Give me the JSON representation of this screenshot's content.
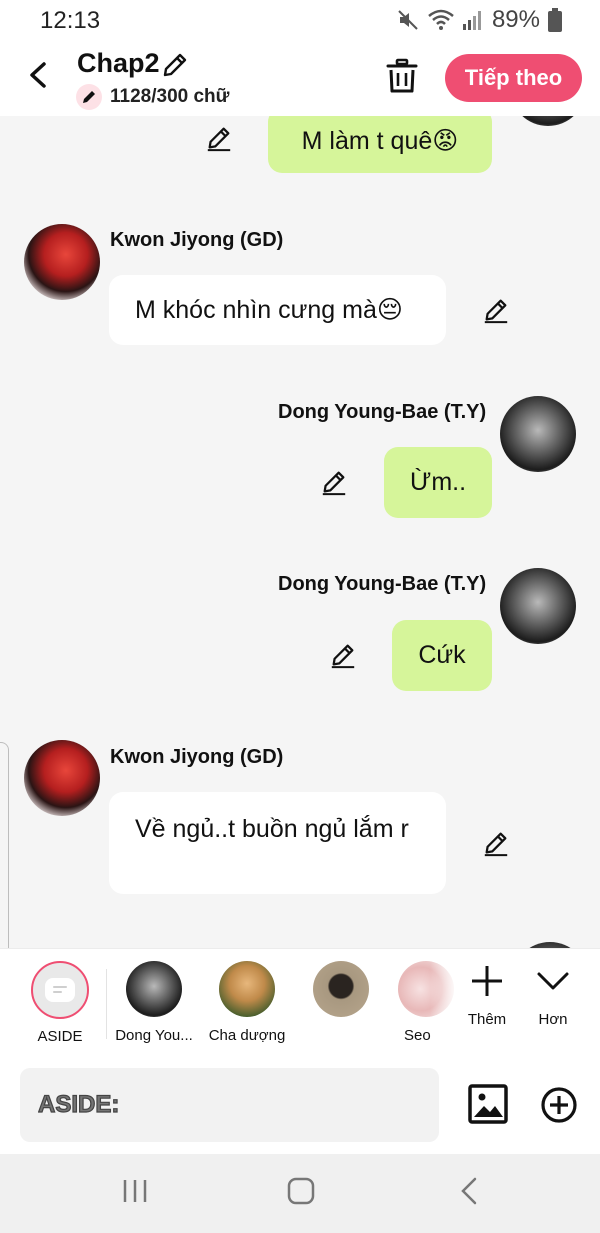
{
  "status_bar": {
    "time": "12:13",
    "battery": "89%"
  },
  "header": {
    "title": "Chap2",
    "word_count": "1128/300 chữ",
    "next_label": "Tiếp theo"
  },
  "messages": [
    {
      "side": "right",
      "sender": "",
      "text": "M làm t quê😡"
    },
    {
      "side": "left",
      "sender": "Kwon Jiyong (GD)",
      "text": "M khóc nhìn cưng mà😔"
    },
    {
      "side": "right",
      "sender": "Dong Young-Bae (T.Y)",
      "text": "Ừm.."
    },
    {
      "side": "right",
      "sender": "Dong Young-Bae (T.Y)",
      "text": "Cứk"
    },
    {
      "side": "left",
      "sender": "Kwon Jiyong (GD)",
      "text": "Về ngủ..t buồn ngủ lắm r"
    }
  ],
  "characters": [
    {
      "label": "ASIDE"
    },
    {
      "label": "Dong You..."
    },
    {
      "label": "Cha dượng"
    },
    {
      "label": ""
    },
    {
      "label": "Seo"
    }
  ],
  "tools": {
    "add_label": "Thêm",
    "more_label": "Hơn"
  },
  "composer": {
    "placeholder": "ASIDE:"
  },
  "colors": {
    "accent": "#ef4e72",
    "right_bubble": "#d6f59a",
    "left_bubble": "#ffffff"
  }
}
